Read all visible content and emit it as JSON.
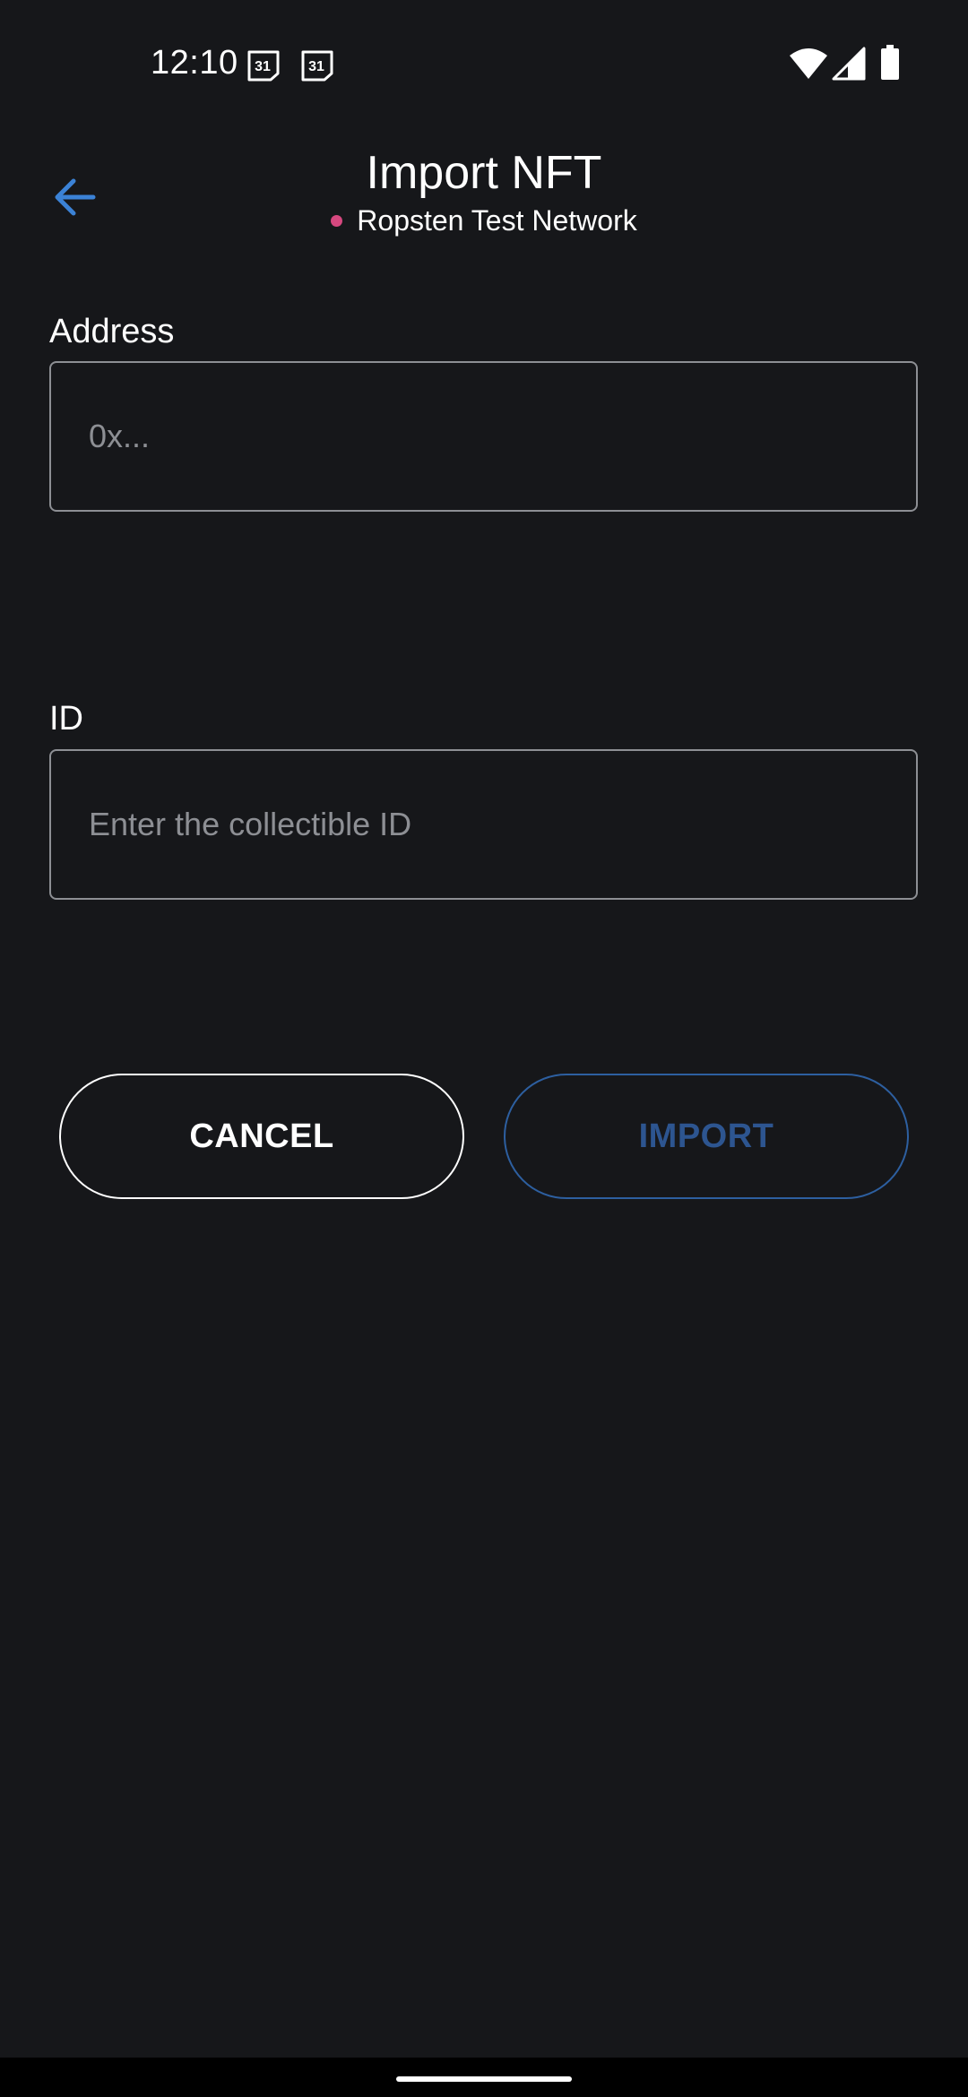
{
  "status_bar": {
    "time": "12:10",
    "calendar_day_1": "31",
    "calendar_day_2": "31",
    "icons": [
      "calendar-icon",
      "calendar-icon",
      "wifi-icon",
      "cellular-signal-icon",
      "battery-icon"
    ]
  },
  "header": {
    "title": "Import NFT",
    "network_name": "Ropsten Test Network",
    "network_dot_color": "#d6487f",
    "back_icon": "arrow-left-icon",
    "back_icon_color": "#3b82d6"
  },
  "form": {
    "address": {
      "label": "Address",
      "placeholder": "0x...",
      "value": ""
    },
    "id": {
      "label": "ID",
      "placeholder": "Enter the collectible ID",
      "value": ""
    }
  },
  "actions": {
    "cancel_label": "CANCEL",
    "import_label": "IMPORT",
    "import_color": "#2d5590"
  },
  "colors": {
    "background": "#16171a",
    "input_border": "#8d8f94",
    "accent": "#3b82d6"
  }
}
